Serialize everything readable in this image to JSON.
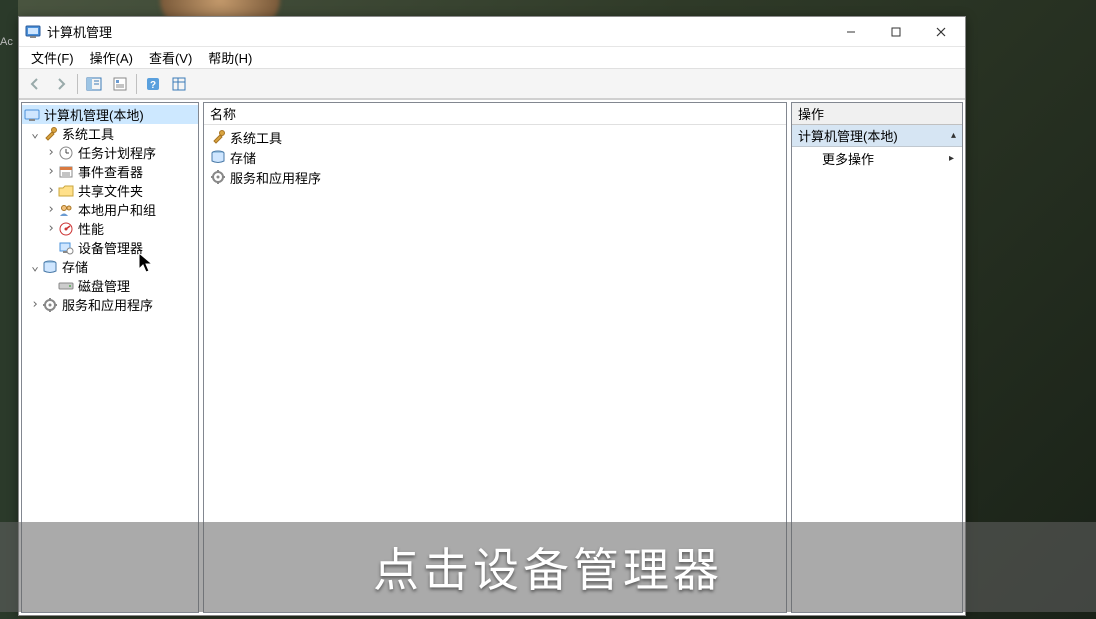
{
  "window": {
    "title": "计算机管理"
  },
  "menus": {
    "file": "文件(F)",
    "action": "操作(A)",
    "view": "查看(V)",
    "help": "帮助(H)"
  },
  "tree": {
    "root": "计算机管理(本地)",
    "system_tools": "系统工具",
    "task_scheduler": "任务计划程序",
    "event_viewer": "事件查看器",
    "shared_folders": "共享文件夹",
    "local_users": "本地用户和组",
    "performance": "性能",
    "device_manager": "设备管理器",
    "storage": "存储",
    "disk_management": "磁盘管理",
    "services_apps": "服务和应用程序"
  },
  "middle": {
    "header": "名称",
    "items": {
      "system_tools": "系统工具",
      "storage": "存储",
      "services_apps": "服务和应用程序"
    }
  },
  "actions": {
    "header": "操作",
    "section": "计算机管理(本地)",
    "more": "更多操作"
  },
  "caption": "点击设备管理器",
  "glyphs": {
    "expanded": "⌄",
    "collapsed": "›",
    "up_triangle": "▴",
    "right_triangle": "▸"
  }
}
